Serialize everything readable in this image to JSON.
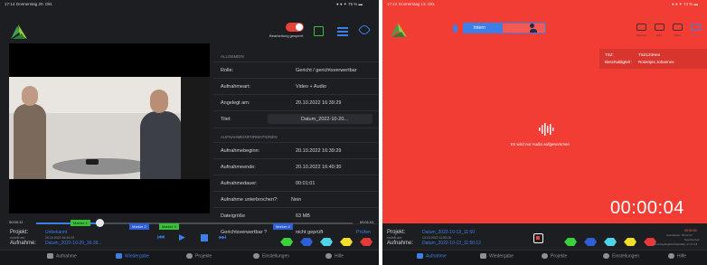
{
  "left": {
    "status_time": "17:14",
    "status_date": "Donnerstag 20. Okt.",
    "status_right": "● ● ✦ 75 % ▬",
    "edit_label": "Bearbeitung gesperrt",
    "general_header": "ALLGEMEIN",
    "general_rows": [
      {
        "key": "Rolle:",
        "value": "Gericht / gerichtsverwertbar"
      },
      {
        "key": "Aufnahmeart:",
        "value": "Video + Audio"
      },
      {
        "key": "Angelegt am:",
        "value": "20.10.2022 16:39:29"
      },
      {
        "key": "Titel:",
        "value": "Datum_2022-10-20..."
      }
    ],
    "recinfo_header": "AUFNAHMEINFORMATIONEN",
    "recinfo_rows": [
      {
        "key": "Aufnahmebeginn:",
        "value": "20.10.2022 16:39:29"
      },
      {
        "key": "Aufnahmeende:",
        "value": "20.10.2022 16:40:30"
      },
      {
        "key": "Aufnahmedauer:",
        "value": "00:01:01"
      },
      {
        "key": "Aufnahme unterbrochen?:",
        "value": "Nein"
      },
      {
        "key": "Dateigröße",
        "value": "63 MB"
      },
      {
        "key": "Gerichtsverwertbar ?",
        "value": "nicht geprüft",
        "action": "Prüfen"
      }
    ],
    "time_start": "00:00:11",
    "time_end": "00:01:01",
    "marker_labels": [
      "Marker 1",
      "Marker 2",
      "Marker 3",
      "Marker 4"
    ],
    "project_label": "Projekt:",
    "project_value": "Unbekannt",
    "project_sub": "erstellt am:",
    "project_date": "20.10.2022 16:44:23",
    "recording_label": "Aufnahme:",
    "recording_value": "Datum_2022-10-20_16:39...",
    "tabs": [
      "Aufnahme",
      "Wiedergabe",
      "Projekte",
      "Einstellungen",
      "Hilfe"
    ]
  },
  "right": {
    "status_time": "17:12",
    "status_date": "Donnerstag 13. Okt.",
    "status_right": "● ● ✦ 74 % ▬",
    "mode_label": "Intern",
    "cam_labels": [
      "Kamera",
      "Foto",
      "Video",
      "Ton"
    ],
    "tsz_label": "TSZ:",
    "tsz_value": "TSZ123Hex",
    "acc_label": "Beschuldigte/r:",
    "acc_value": "Rosenjes Johannes",
    "audio_message": "Es wird nur Audio aufgenommen",
    "timer": "00:00:04",
    "project_label": "Projekt:",
    "project_value": "Datum_2022-10-13_11:50",
    "project_sub": "erstellt am:",
    "project_date": "13.10.2022 11:50:16",
    "recording_label": "Aufnahme:",
    "recording_value": "Datum_2022-10-13_11:50:12",
    "info_lines": [
      "00:00:00",
      "Audiodauer: 00:12:17",
      "Speicherzeit",
      "Rechtsgültig/Rechtskräftig: 17:17:13"
    ],
    "tabs": [
      "Aufnahme",
      "Wiedergabe",
      "Projekte",
      "Einstellungen",
      "Hilfe"
    ]
  },
  "colors": {
    "panel_bg": "#1c1e21",
    "recording_red": "#f23d35",
    "accent_blue": "#3d7fe6",
    "toggle_red": "#e8413a",
    "marker_green": "#3bbf3a",
    "marker_blue": "#2f5fd7",
    "flag_colors": [
      "#3bd13b",
      "#2f5fd7",
      "#4fd4e8",
      "#f2df2a",
      "#e63a3a"
    ]
  }
}
